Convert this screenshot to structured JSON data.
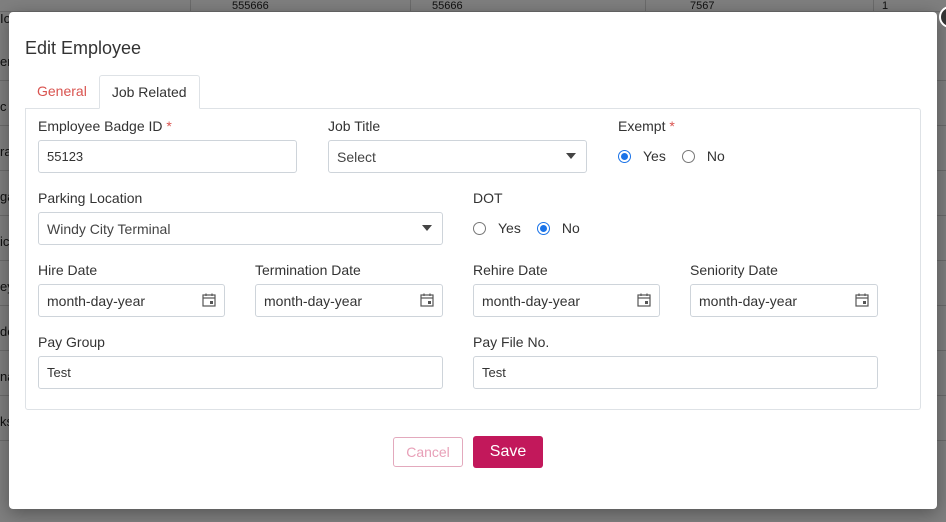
{
  "background": {
    "row_stubs": [
      "Io",
      "er",
      "c",
      "ra",
      "ga",
      "ic",
      "ey",
      "de",
      "na",
      "ks"
    ],
    "header_cells": [
      "555666",
      "55666",
      "7567",
      "1"
    ]
  },
  "modal": {
    "title": "Edit Employee",
    "close_glyph": "×",
    "tabs": [
      {
        "label": "General",
        "active": false
      },
      {
        "label": "Job Related",
        "active": true
      }
    ],
    "fields": {
      "badge_id": {
        "label": "Employee Badge ID",
        "required_mark": "*",
        "value": "55123"
      },
      "job_title": {
        "label": "Job Title",
        "value": "Select"
      },
      "exempt": {
        "label": "Exempt",
        "required_mark": "*",
        "options": [
          "Yes",
          "No"
        ],
        "selected": "Yes"
      },
      "parking": {
        "label": "Parking Location",
        "value": "Windy City Terminal"
      },
      "dot": {
        "label": "DOT",
        "options": [
          "Yes",
          "No"
        ],
        "selected": "No"
      },
      "hire_date": {
        "label": "Hire Date",
        "placeholder": "month-day-year"
      },
      "termination_date": {
        "label": "Termination Date",
        "placeholder": "month-day-year"
      },
      "rehire_date": {
        "label": "Rehire Date",
        "placeholder": "month-day-year"
      },
      "seniority_date": {
        "label": "Seniority Date",
        "placeholder": "month-day-year"
      },
      "pay_group": {
        "label": "Pay Group",
        "value": "Test"
      },
      "pay_file_no": {
        "label": "Pay File No.",
        "value": "Test"
      }
    },
    "buttons": {
      "cancel": "Cancel",
      "save": "Save"
    }
  },
  "colors": {
    "accent": "#c2185b",
    "required": "#d9534f",
    "radio": "#1a73e8"
  },
  "icons": {
    "date_picker": "calendar-icon",
    "dropdown": "caret-down-icon",
    "close": "close-icon"
  }
}
